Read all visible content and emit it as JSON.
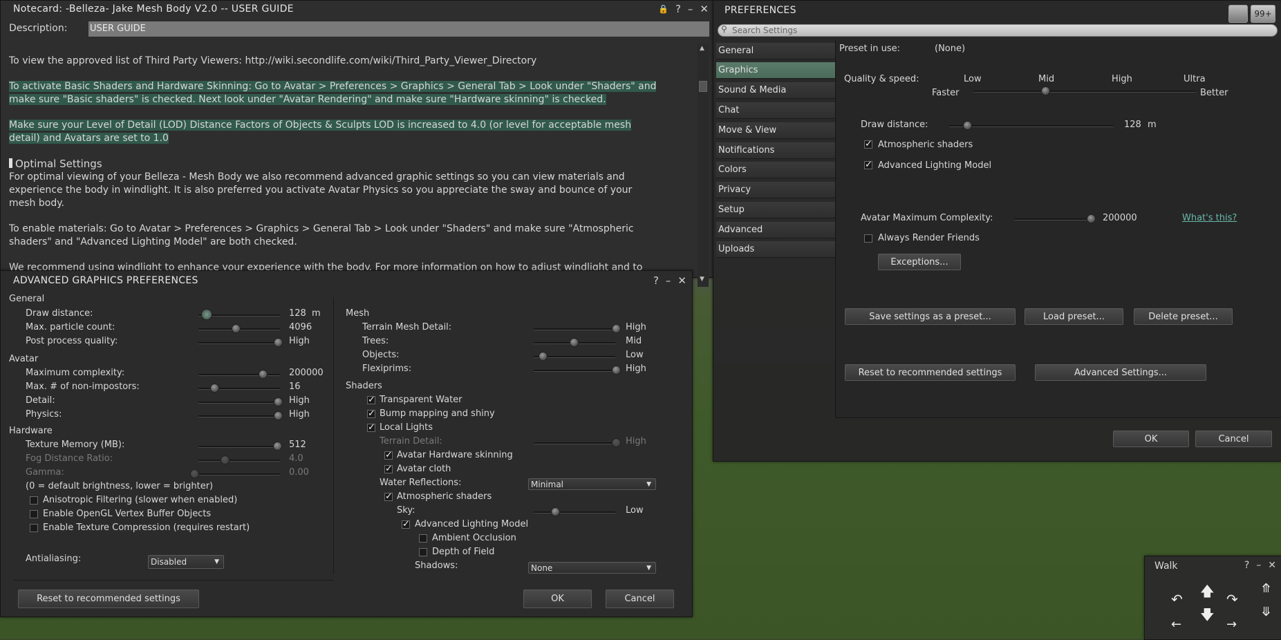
{
  "notecard": {
    "title": "Notecard: -Belleza- Jake Mesh Body V2.0 -- USER GUIDE",
    "description_label": "Description:",
    "description_value": "USER GUIDE",
    "lines": {
      "l1": "To view the approved list of Third Party Viewers: http://wiki.secondlife.com/wiki/Third_Party_Viewer_Directory",
      "l2a": "To activate Basic Shaders and Hardware Skinning: Go to Avatar > Preferences > Graphics > General Tab > Look under \"Shaders\" and",
      "l2b": "make sure \"Basic shaders\" is checked. Next look under \"Avatar Rendering\" and make sure \"Hardware skinning\" is checked.",
      "l3a": "Make sure your Level of Detail (LOD) Distance Factors of Objects & Sculpts LOD is increased to 4.0 (or level for acceptable mesh",
      "l3b": "detail) and Avatars are set to 1.0",
      "heading": "Optimal Settings",
      "l4a": "For optimal viewing of your Belleza - Mesh Body we also recommend advanced graphic settings so you can view materials and",
      "l4b": "experience the body in windlight.  It is also preferred you activate Avatar Physics so you appreciate the sway and bounce of your",
      "l4c": "mesh body.",
      "l5a": "To enable materials: Go to Avatar > Preferences > Graphics > General Tab > Look under \"Shaders\" and make sure \"Atmospheric",
      "l5b": "shaders\" and \"Advanced Lighting Model\" are both checked.",
      "l6": "We recommend using windlight to enhance your experience with the body. For more information on how to adjust windlight and to"
    }
  },
  "prefs": {
    "title": "PREFERENCES",
    "badge": "99+",
    "search_placeholder": "Search Settings",
    "nav": [
      "General",
      "Graphics",
      "Sound & Media",
      "Chat",
      "Move & View",
      "Notifications",
      "Colors",
      "Privacy",
      "Setup",
      "Advanced",
      "Uploads"
    ],
    "preset_label": "Preset in use:",
    "preset_value": "(None)",
    "quality_label": "Quality & speed:",
    "q_low": "Low",
    "q_mid": "Mid",
    "q_high": "High",
    "q_ultra": "Ultra",
    "q_faster": "Faster",
    "q_better": "Better",
    "draw_label": "Draw distance:",
    "draw_value": "128",
    "draw_unit": "m",
    "atmos": "Atmospheric shaders",
    "alm": "Advanced Lighting Model",
    "complexity_label": "Avatar Maximum Complexity:",
    "complexity_value": "200000",
    "whats_this": "What's this?",
    "always_render": "Always Render Friends",
    "exceptions": "Exceptions...",
    "save_preset": "Save settings as a preset...",
    "load_preset": "Load preset...",
    "delete_preset": "Delete preset...",
    "reset": "Reset to recommended settings",
    "advanced": "Advanced Settings...",
    "ok": "OK",
    "cancel": "Cancel"
  },
  "agp": {
    "title": "ADVANCED GRAPHICS PREFERENCES",
    "general": "General",
    "draw_distance": "Draw distance:",
    "draw_distance_val": "128",
    "draw_unit": "m",
    "particles": "Max. particle count:",
    "particles_val": "4096",
    "post": "Post process quality:",
    "post_val": "High",
    "avatar": "Avatar",
    "max_complexity": "Maximum complexity:",
    "max_complexity_val": "200000",
    "non_impostors": "Max. # of non-impostors:",
    "non_impostors_val": "16",
    "detail": "Detail:",
    "detail_val": "High",
    "physics": "Physics:",
    "physics_val": "High",
    "hardware": "Hardware",
    "texture_mem": "Texture Memory (MB):",
    "texture_mem_val": "512",
    "fog": "Fog Distance Ratio:",
    "fog_val": "4.0",
    "gamma": "Gamma:",
    "gamma_val": "0.00",
    "gamma_note": "(0 = default brightness, lower = brighter)",
    "aniso": "Anisotropic Filtering (slower when enabled)",
    "vbo": "Enable OpenGL Vertex Buffer Objects",
    "tex_comp": "Enable Texture Compression (requires restart)",
    "antialiasing": "Antialiasing:",
    "antialiasing_val": "Disabled",
    "mesh": "Mesh",
    "terrain_mesh": "Terrain Mesh Detail:",
    "terrain_mesh_val": "High",
    "trees": "Trees:",
    "trees_val": "Mid",
    "objects": "Objects:",
    "objects_val": "Low",
    "flexiprims": "Flexiprims:",
    "flexiprims_val": "High",
    "shaders": "Shaders",
    "transparent_water": "Transparent Water",
    "bump": "Bump mapping and shiny",
    "local_lights": "Local Lights",
    "terrain_detail": "Terrain Detail:",
    "terrain_detail_val": "High",
    "hw_skinning": "Avatar Hardware skinning",
    "avatar_cloth": "Avatar cloth",
    "water_refl": "Water Reflections:",
    "water_refl_val": "Minimal",
    "atmos": "Atmospheric shaders",
    "sky": "Sky:",
    "sky_val": "Low",
    "alm": "Advanced Lighting Model",
    "ao": "Ambient Occlusion",
    "dof": "Depth of Field",
    "shadows": "Shadows:",
    "shadows_val": "None",
    "reset": "Reset to recommended settings",
    "ok": "OK",
    "cancel": "Cancel"
  },
  "walk": {
    "title": "Walk"
  }
}
